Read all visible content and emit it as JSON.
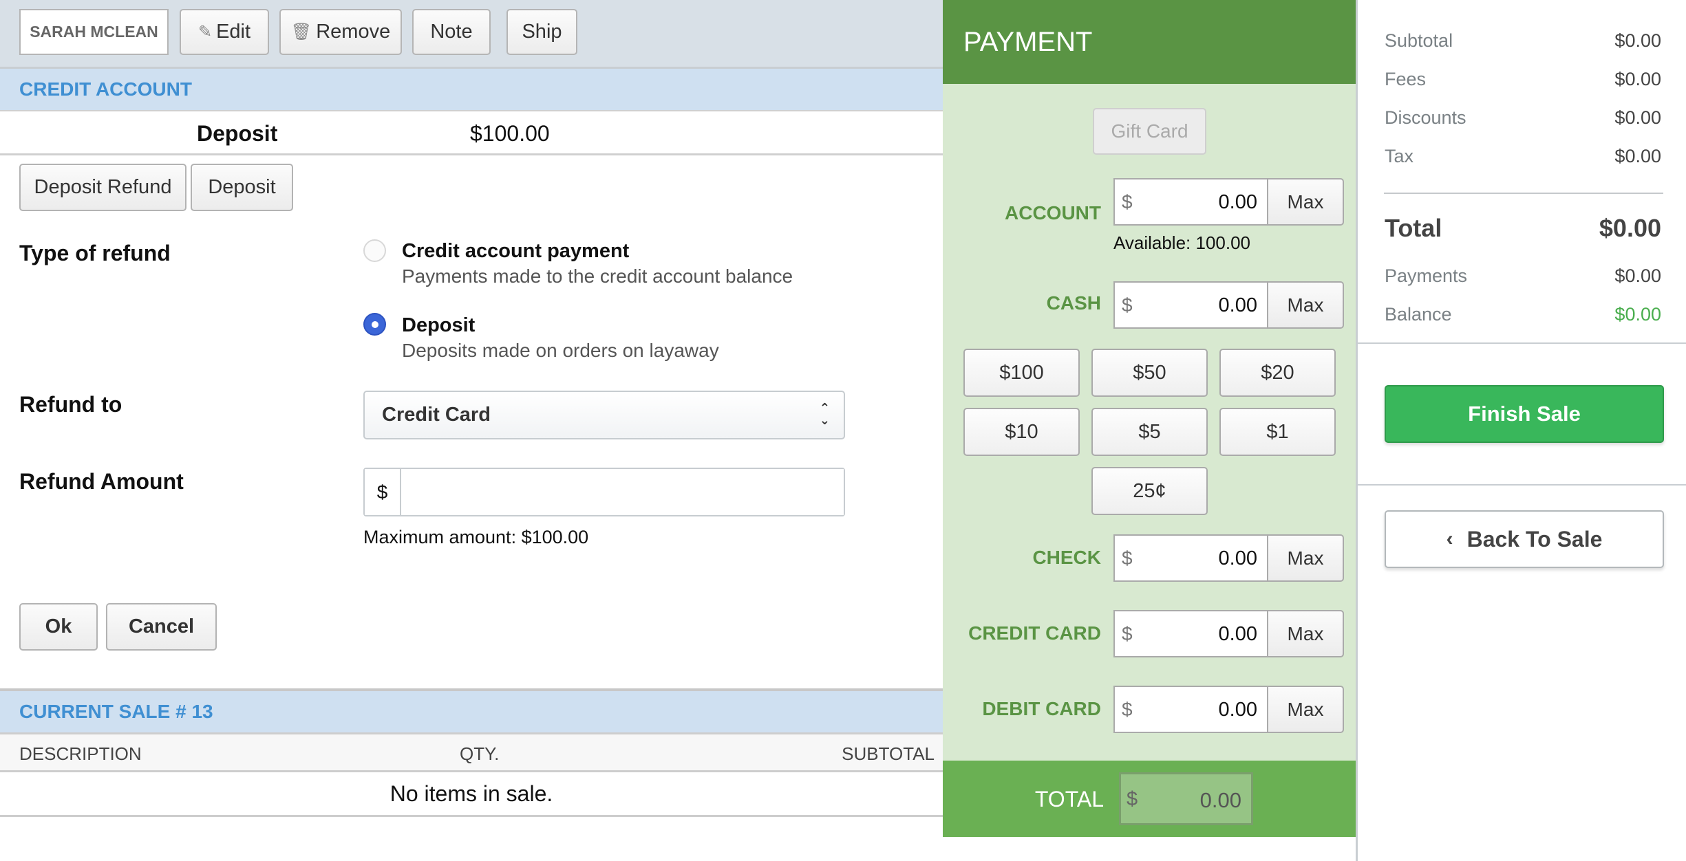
{
  "toolbar": {
    "customer_name": "SARAH MCLEAN",
    "edit_label": "Edit",
    "remove_label": "Remove",
    "note_label": "Note",
    "ship_label": "Ship"
  },
  "credit_account": {
    "header": "CREDIT ACCOUNT",
    "deposit_label": "Deposit",
    "deposit_value": "$100.00",
    "deposit_refund_button": "Deposit Refund",
    "deposit_button": "Deposit"
  },
  "refund_form": {
    "type_label": "Type of refund",
    "options": [
      {
        "title": "Credit account payment",
        "description": "Payments made to the credit account balance",
        "selected": false
      },
      {
        "title": "Deposit",
        "description": "Deposits made on orders on layaway",
        "selected": true
      }
    ],
    "refund_to_label": "Refund to",
    "refund_to_value": "Credit Card",
    "amount_label": "Refund Amount",
    "amount_currency": "$",
    "amount_value": "",
    "max_amount_note": "Maximum amount: $100.00",
    "ok_label": "Ok",
    "cancel_label": "Cancel"
  },
  "current_sale": {
    "header": "CURRENT SALE # 13",
    "columns": [
      "DESCRIPTION",
      "QTY.",
      "SUBTOTAL"
    ],
    "empty_message": "No items in sale."
  },
  "payment": {
    "header": "PAYMENT",
    "gift_card_label": "Gift Card",
    "currency": "$",
    "max_label": "Max",
    "methods": [
      {
        "label": "ACCOUNT",
        "value": "0.00"
      },
      {
        "label": "CASH",
        "value": "0.00"
      },
      {
        "label": "CHECK",
        "value": "0.00"
      },
      {
        "label": "CREDIT CARD",
        "value": "0.00"
      },
      {
        "label": "DEBIT CARD",
        "value": "0.00"
      }
    ],
    "account_available": "Available: 100.00",
    "cash_buttons": [
      "$100",
      "$50",
      "$20",
      "$10",
      "$5",
      "$1",
      "25¢"
    ],
    "total_label": "TOTAL",
    "total_value": "0.00"
  },
  "summary": {
    "rows": [
      {
        "label": "Subtotal",
        "value": "$0.00"
      },
      {
        "label": "Fees",
        "value": "$0.00"
      },
      {
        "label": "Discounts",
        "value": "$0.00"
      },
      {
        "label": "Tax",
        "value": "$0.00"
      }
    ],
    "total_label": "Total",
    "total_value": "$0.00",
    "payments_label": "Payments",
    "payments_value": "$0.00",
    "balance_label": "Balance",
    "balance_value": "$0.00",
    "balance_color": "#4aae4e",
    "finish_sale_label": "Finish Sale",
    "back_to_sale_label": "Back To Sale"
  }
}
